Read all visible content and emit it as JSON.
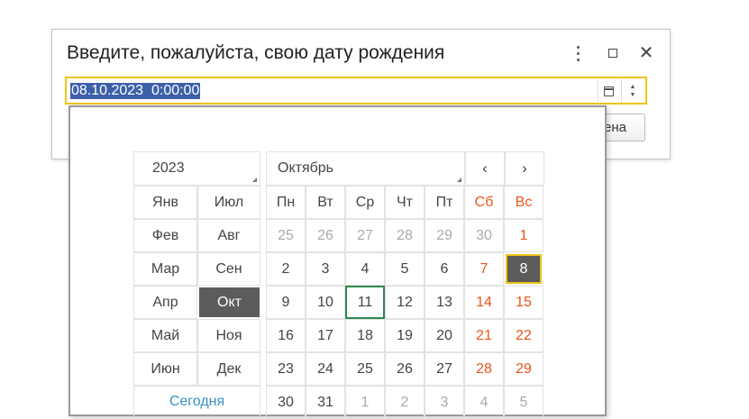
{
  "dialog": {
    "title": "Введите, пожалуйста, свою дату рождения",
    "date_value": "08.10.2023  0:00:00",
    "cancel_label": "ена"
  },
  "calendar": {
    "year": "2023",
    "month_title": "Октябрь",
    "prev_glyph": "‹",
    "next_glyph": "›",
    "today_label": "Сегодня",
    "months": [
      "Янв",
      "Фев",
      "Мар",
      "Апр",
      "Май",
      "Июн",
      "Июл",
      "Авг",
      "Сен",
      "Окт",
      "Ноя",
      "Дек"
    ],
    "selected_month": "Окт",
    "weekdays": [
      "Пн",
      "Вт",
      "Ср",
      "Чт",
      "Пт",
      "Сб",
      "Вс"
    ],
    "weeks": [
      [
        "25",
        "26",
        "27",
        "28",
        "29",
        "30",
        "1"
      ],
      [
        "2",
        "3",
        "4",
        "5",
        "6",
        "7",
        "8"
      ],
      [
        "9",
        "10",
        "11",
        "12",
        "13",
        "14",
        "15"
      ],
      [
        "16",
        "17",
        "18",
        "19",
        "20",
        "21",
        "22"
      ],
      [
        "23",
        "24",
        "25",
        "26",
        "27",
        "28",
        "29"
      ],
      [
        "30",
        "31",
        "1",
        "2",
        "3",
        "4",
        "5"
      ]
    ],
    "selected_day": "8",
    "today_day": "11",
    "colors": {
      "weekend": "#e8561b",
      "selected_bg": "#5c5c5c",
      "focus": "#f0c419",
      "today_border": "#2b8a4e",
      "link": "#3a8fc7"
    }
  }
}
